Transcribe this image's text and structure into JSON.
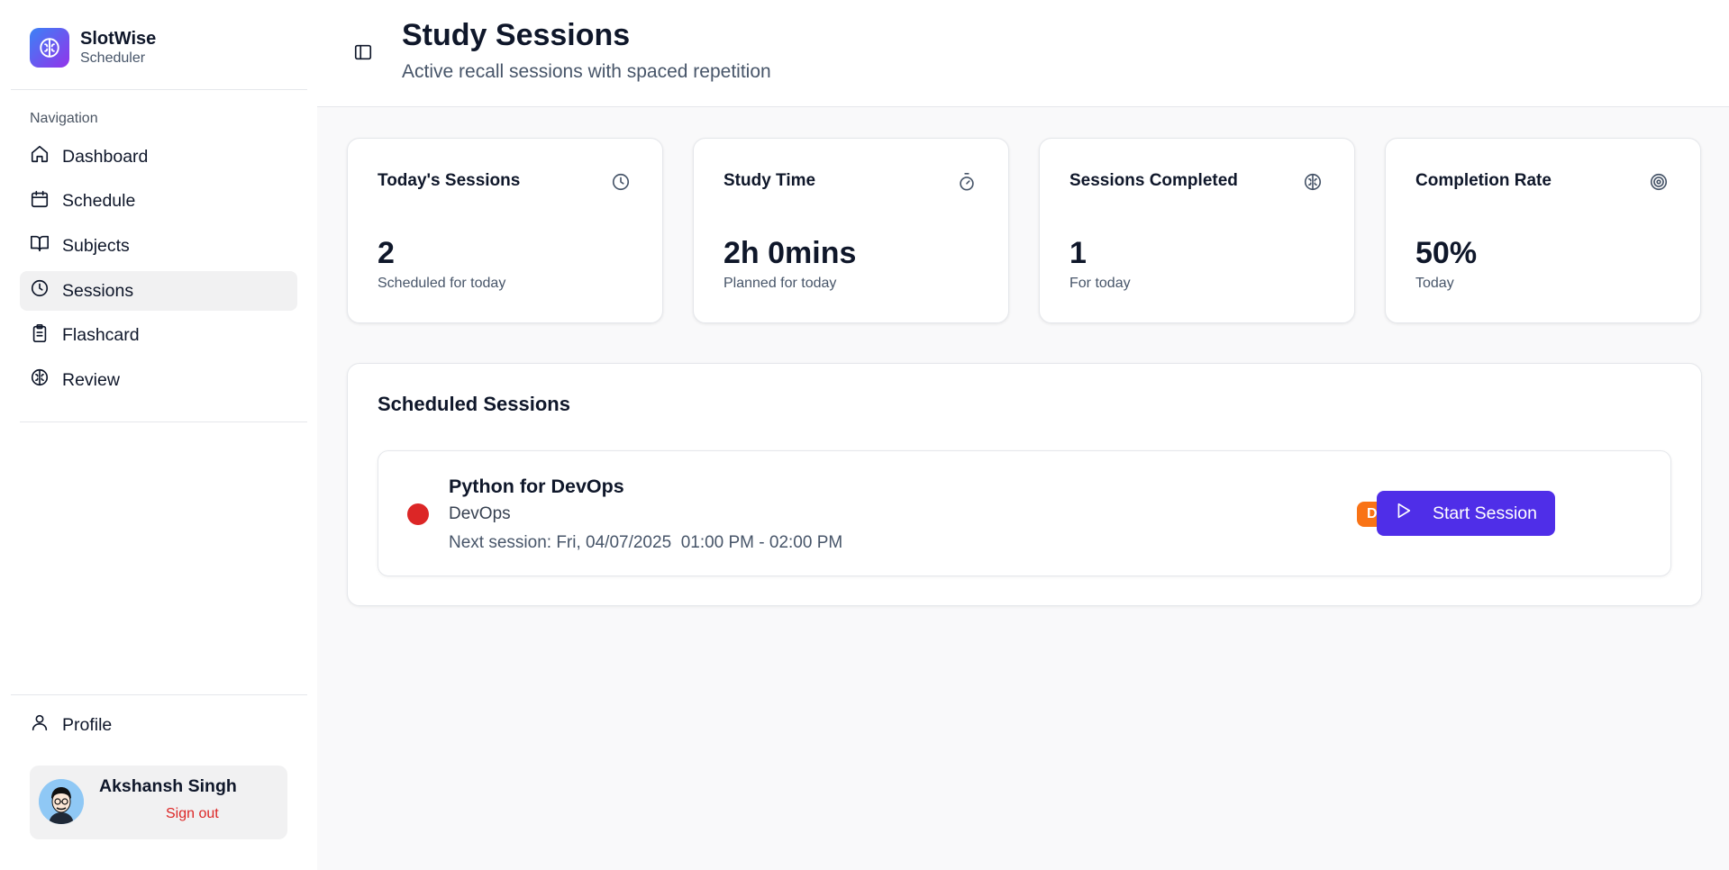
{
  "brand": {
    "name": "SlotWise",
    "subtitle": "Scheduler",
    "logo_icon": "brain-icon",
    "gradient": [
      "#3b82f6",
      "#9333ea"
    ]
  },
  "sidebar": {
    "heading": "Navigation",
    "items": [
      {
        "label": "Dashboard",
        "icon": "home-icon",
        "active": false
      },
      {
        "label": "Schedule",
        "icon": "calendar-icon",
        "active": false
      },
      {
        "label": "Subjects",
        "icon": "book-open-icon",
        "active": false
      },
      {
        "label": "Sessions",
        "icon": "clock-icon",
        "active": true
      },
      {
        "label": "Flashcard",
        "icon": "clipboard-icon",
        "active": false
      },
      {
        "label": "Review",
        "icon": "brain-icon",
        "active": false
      }
    ],
    "profile_label": "Profile"
  },
  "user": {
    "name": "Akshansh Singh",
    "sign_out": "Sign out"
  },
  "header": {
    "title": "Study Sessions",
    "subtitle": "Active recall sessions with spaced repetition"
  },
  "stats": [
    {
      "label": "Today's Sessions",
      "value": "2",
      "caption": "Scheduled for today",
      "icon": "clock-icon"
    },
    {
      "label": "Study Time",
      "value": "2h 0mins",
      "caption": "Planned for today",
      "icon": "timer-icon"
    },
    {
      "label": "Sessions Completed",
      "value": "1",
      "caption": "For today",
      "icon": "brain-icon"
    },
    {
      "label": "Completion Rate",
      "value": "50%",
      "caption": "Today",
      "icon": "target-icon"
    }
  ],
  "scheduled": {
    "title": "Scheduled Sessions",
    "sessions": [
      {
        "title": "Python for DevOps",
        "subject": "DevOps",
        "next": "Next session: Fri, 04/07/2025  01:00 PM - 02:00 PM",
        "badge": "Due Now",
        "button": "Start Session",
        "dot_color": "#dc2626"
      }
    ]
  },
  "colors": {
    "accent": "#4f2ee8",
    "badge": "#f97316",
    "danger": "#dc2626"
  }
}
